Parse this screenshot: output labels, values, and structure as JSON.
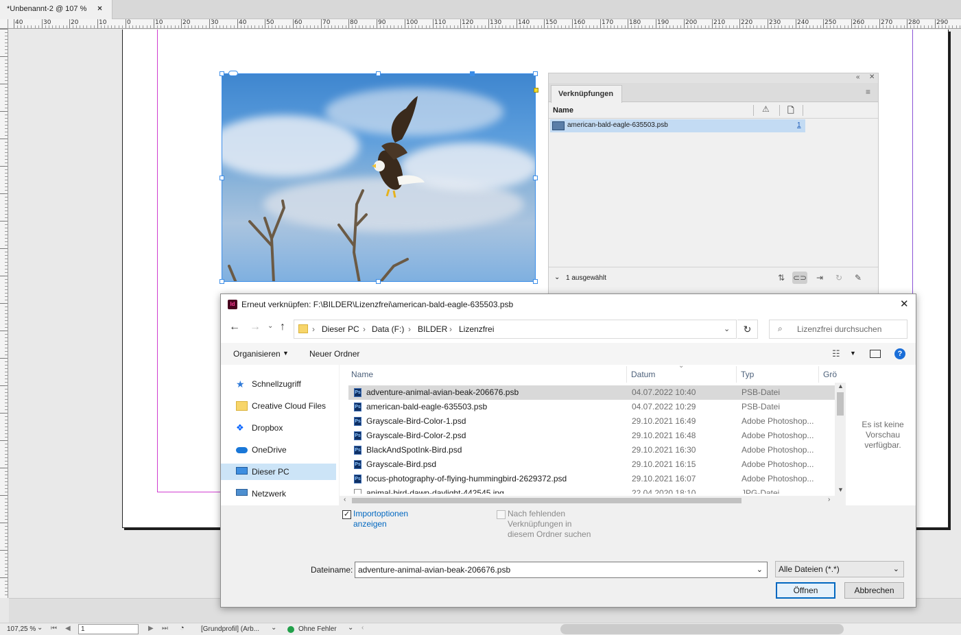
{
  "document": {
    "tab_title": "*Unbenannt-2 @ 107 %",
    "tab_close": "×"
  },
  "ruler": {
    "h_labels": [
      "40",
      "30",
      "20",
      "10",
      "0",
      "10",
      "20",
      "30",
      "40",
      "50",
      "60",
      "70",
      "80",
      "90",
      "100",
      "110",
      "120",
      "130",
      "140",
      "150",
      "160",
      "170",
      "180",
      "190",
      "200",
      "210",
      "220",
      "230",
      "240",
      "250",
      "260",
      "270",
      "280",
      "290"
    ]
  },
  "links_panel": {
    "tab_label": "Verknüpfungen",
    "column_name": "Name",
    "row": {
      "name": "american-bald-eagle-635503.psb",
      "page": "1"
    },
    "footer_status": "1 ausgewählt"
  },
  "dialog": {
    "title": "Erneut verknüpfen: F:\\BILDER\\Lizenzfrei\\american-bald-eagle-635503.psb",
    "app_icon": "Id",
    "breadcrumb": [
      "Dieser PC",
      "Data (F:)",
      "BILDER",
      "Lizenzfrei"
    ],
    "search_placeholder": "Lizenzfrei durchsuchen",
    "toolbar": {
      "organize": "Organisieren",
      "new_folder": "Neuer Ordner"
    },
    "nav_items": [
      {
        "label": "Schnellzugriff",
        "icon": "star-icon"
      },
      {
        "label": "Creative Cloud Files",
        "icon": "creative-cloud-folder-icon"
      },
      {
        "label": "Dropbox",
        "icon": "dropbox-icon"
      },
      {
        "label": "OneDrive",
        "icon": "onedrive-icon"
      },
      {
        "label": "Dieser PC",
        "icon": "computer-icon"
      },
      {
        "label": "Netzwerk",
        "icon": "network-icon"
      }
    ],
    "columns": {
      "name": "Name",
      "date": "Datum",
      "type": "Typ",
      "size": "Grö"
    },
    "files": [
      {
        "name": "adventure-animal-avian-beak-206676.psb",
        "date": "04.07.2022 10:40",
        "type": "PSB-Datei"
      },
      {
        "name": "american-bald-eagle-635503.psb",
        "date": "04.07.2022 10:29",
        "type": "PSB-Datei"
      },
      {
        "name": "Grayscale-Bird-Color-1.psd",
        "date": "29.10.2021 16:49",
        "type": "Adobe Photoshop..."
      },
      {
        "name": "Grayscale-Bird-Color-2.psd",
        "date": "29.10.2021 16:48",
        "type": "Adobe Photoshop..."
      },
      {
        "name": "BlackAndSpotInk-Bird.psd",
        "date": "29.10.2021 16:30",
        "type": "Adobe Photoshop..."
      },
      {
        "name": "Grayscale-Bird.psd",
        "date": "29.10.2021 16:15",
        "type": "Adobe Photoshop..."
      },
      {
        "name": "focus-photography-of-flying-hummingbird-2629372.psd",
        "date": "29.10.2021 16:07",
        "type": "Adobe Photoshop..."
      },
      {
        "name": "animal-bird-dawn-daylight-442545.jpg",
        "date": "22.04.2020 18:10",
        "type": "JPG-Datei"
      }
    ],
    "preview_text": "Es ist keine Vorschau verfügbar.",
    "option_import": "Importoptionen anzeigen",
    "option_search": "Nach fehlenden Verknüpfungen in diesem Ordner suchen",
    "filename_label": "Dateiname:",
    "filename_value": "adventure-animal-avian-beak-206676.psb",
    "filetype_value": "Alle Dateien (*.*)",
    "open_button": "Öffnen",
    "cancel_button": "Abbrechen",
    "close_glyph": "✕"
  },
  "statusbar": {
    "zoom": "107,25 %",
    "page": "1",
    "profile": "[Grundprofil] (Arb...",
    "errors": "Ohne Fehler"
  },
  "colors": {
    "accent": "#0067c0",
    "selection": "#c3dbf3",
    "frame": "#3b8de8",
    "margin_magenta": "#d03cd0",
    "ok_green": "#22a04a"
  }
}
